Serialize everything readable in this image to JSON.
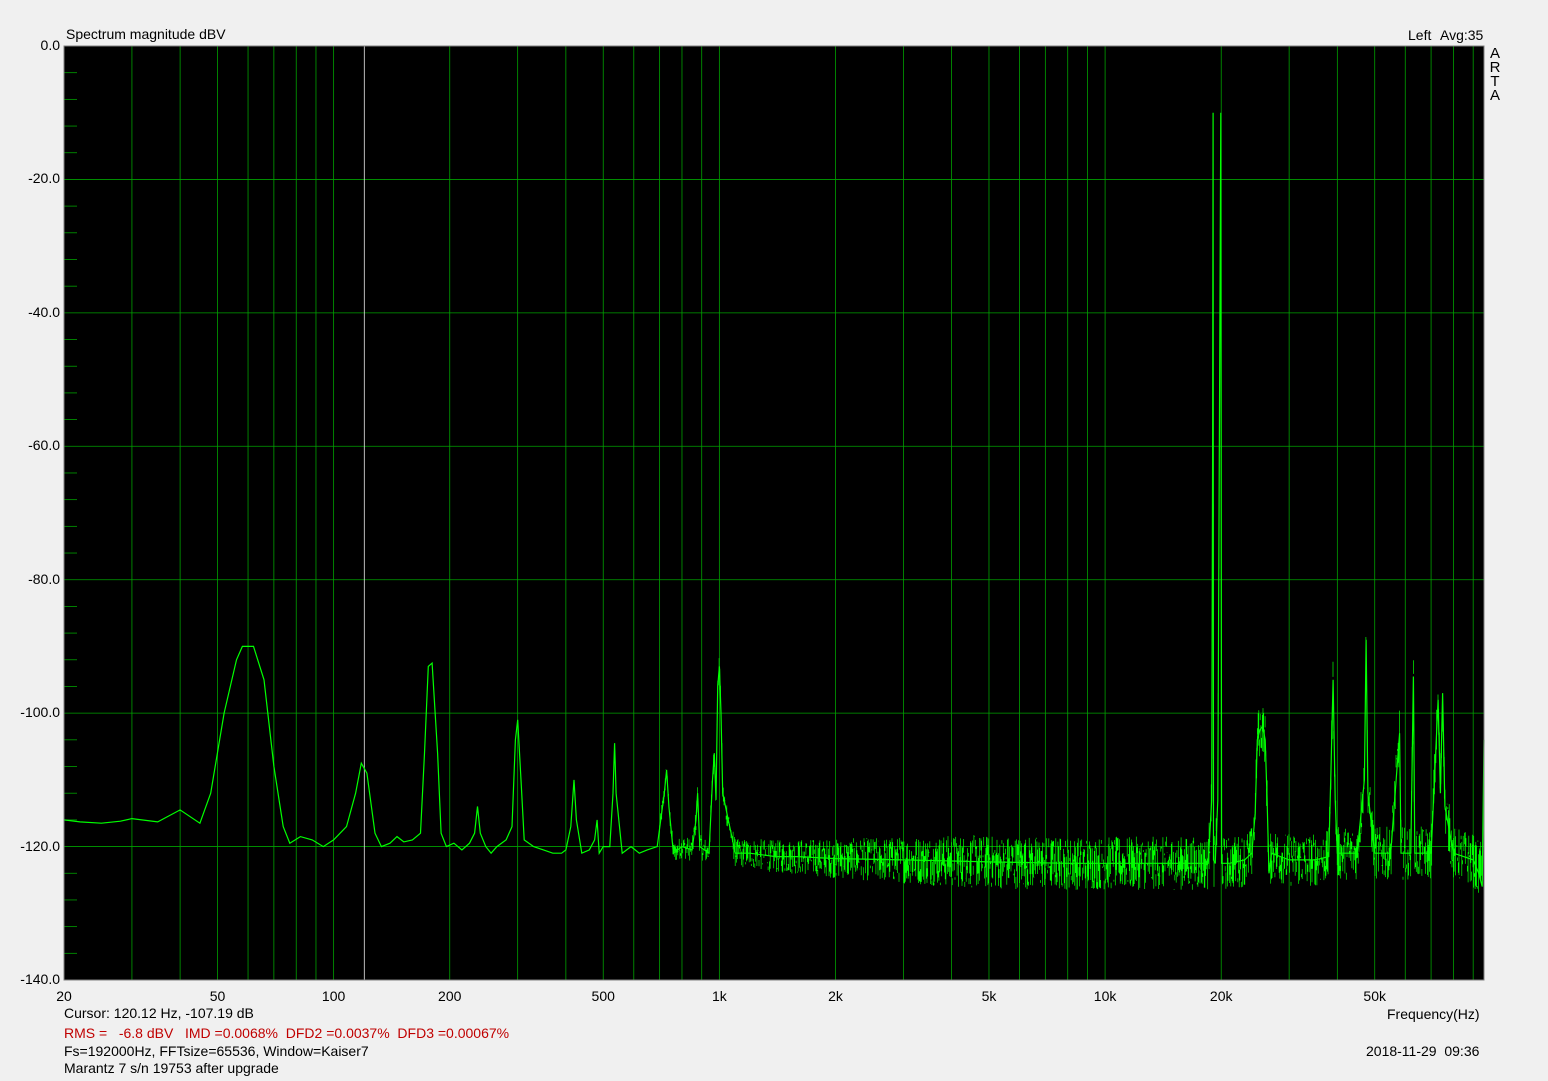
{
  "header": {
    "title": "Spectrum magnitude dBV",
    "channel": "Left",
    "avg": "Avg:35",
    "brand_letters": [
      "A",
      "R",
      "T",
      "A"
    ]
  },
  "footer": {
    "cursor": "Cursor: 120.12 Hz, -107.19 dB",
    "rms": "RMS =   -6.8 dBV   IMD =0.0068%  DFD2 =0.0037%  DFD3 =0.00067%",
    "fft": "Fs=192000Hz, FFTsize=65536, Window=Kaiser7",
    "device": "Marantz 7 s/n 19753 after upgrade",
    "frequency_label": "Frequency(Hz)",
    "datetime": "2018-11-29  09:36"
  },
  "colors": {
    "background": "#000000",
    "grid": "#00a000",
    "trace": "#00ff00",
    "window": "#f0f0f0",
    "stats_text": "#c00000"
  },
  "chart_data": {
    "type": "line",
    "title": "Spectrum magnitude dBV",
    "xlabel": "Frequency(Hz)",
    "ylabel": "dBV",
    "xscale": "log",
    "xlim": [
      20,
      96000
    ],
    "ylim": [
      -140,
      0
    ],
    "grid": true,
    "x_tick_labels": [
      {
        "value": 20,
        "label": "20"
      },
      {
        "value": 50,
        "label": "50"
      },
      {
        "value": 100,
        "label": "100"
      },
      {
        "value": 200,
        "label": "200"
      },
      {
        "value": 500,
        "label": "500"
      },
      {
        "value": 1000,
        "label": "1k"
      },
      {
        "value": 2000,
        "label": "2k"
      },
      {
        "value": 5000,
        "label": "5k"
      },
      {
        "value": 10000,
        "label": "10k"
      },
      {
        "value": 20000,
        "label": "20k"
      },
      {
        "value": 50000,
        "label": "50k"
      }
    ],
    "y_tick_labels": [
      {
        "value": 0,
        "label": "0.0"
      },
      {
        "value": -20,
        "label": "-20.0"
      },
      {
        "value": -40,
        "label": "-40.0"
      },
      {
        "value": -60,
        "label": "-60.0"
      },
      {
        "value": -80,
        "label": "-80.0"
      },
      {
        "value": -100,
        "label": "-100.0"
      },
      {
        "value": -120,
        "label": "-120.0"
      },
      {
        "value": -140,
        "label": "-140.0"
      }
    ],
    "series": [
      {
        "color": "#00ff00",
        "points": [
          [
            20,
            -116
          ],
          [
            22,
            -116.3
          ],
          [
            25,
            -116.5
          ],
          [
            28,
            -116.2
          ],
          [
            30,
            -115.8
          ],
          [
            35,
            -116.3
          ],
          [
            40,
            -114.5
          ],
          [
            45,
            -116.5
          ],
          [
            48,
            -112
          ],
          [
            52,
            -100
          ],
          [
            56,
            -92
          ],
          [
            58,
            -90
          ],
          [
            62,
            -90
          ],
          [
            66,
            -95
          ],
          [
            70,
            -108
          ],
          [
            74,
            -117
          ],
          [
            77,
            -119.5
          ],
          [
            82,
            -118.5
          ],
          [
            88,
            -119
          ],
          [
            94,
            -120
          ],
          [
            100,
            -119
          ],
          [
            108,
            -117
          ],
          [
            114,
            -112
          ],
          [
            118,
            -107.5
          ],
          [
            122,
            -109
          ],
          [
            128,
            -118
          ],
          [
            133,
            -120
          ],
          [
            140,
            -119.5
          ],
          [
            146,
            -118.5
          ],
          [
            152,
            -119.3
          ],
          [
            160,
            -119
          ],
          [
            168,
            -118
          ],
          [
            172,
            -106
          ],
          [
            176,
            -93
          ],
          [
            180,
            -92.5
          ],
          [
            186,
            -106
          ],
          [
            190,
            -118
          ],
          [
            196,
            -120
          ],
          [
            205,
            -119.5
          ],
          [
            215,
            -120.5
          ],
          [
            225,
            -119.5
          ],
          [
            232,
            -118
          ],
          [
            236,
            -114
          ],
          [
            240,
            -118
          ],
          [
            248,
            -120
          ],
          [
            256,
            -121
          ],
          [
            265,
            -120
          ],
          [
            280,
            -119
          ],
          [
            290,
            -117
          ],
          [
            296,
            -104
          ],
          [
            300,
            -101
          ],
          [
            306,
            -110
          ],
          [
            312,
            -119
          ],
          [
            330,
            -120
          ],
          [
            350,
            -120.5
          ],
          [
            370,
            -121
          ],
          [
            390,
            -121
          ],
          [
            400,
            -120.5
          ],
          [
            412,
            -117
          ],
          [
            420,
            -110
          ],
          [
            426,
            -116
          ],
          [
            440,
            -121
          ],
          [
            460,
            -120.5
          ],
          [
            475,
            -119
          ],
          [
            482,
            -116
          ],
          [
            488,
            -121
          ],
          [
            500,
            -120
          ],
          [
            520,
            -120
          ],
          [
            530,
            -112
          ],
          [
            535,
            -104.5
          ],
          [
            540,
            -112
          ],
          [
            560,
            -121
          ],
          [
            590,
            -120
          ],
          [
            620,
            -121
          ],
          [
            650,
            -120.5
          ],
          [
            690,
            -120
          ],
          [
            720,
            -112
          ],
          [
            730,
            -108.5
          ],
          [
            740,
            -114
          ],
          [
            760,
            -121
          ],
          [
            800,
            -120
          ],
          [
            850,
            -120.5
          ],
          [
            870,
            -116
          ],
          [
            878,
            -112
          ],
          [
            890,
            -120
          ],
          [
            940,
            -121
          ],
          [
            960,
            -110
          ],
          [
            970,
            -106
          ],
          [
            980,
            -113
          ],
          [
            990,
            -96
          ],
          [
            1000,
            -93
          ],
          [
            1010,
            -100
          ],
          [
            1020,
            -112
          ],
          [
            1100,
            -121
          ],
          [
            1200,
            -121
          ],
          [
            1400,
            -121.5
          ],
          [
            1600,
            -121.5
          ],
          [
            2000,
            -121.8
          ],
          [
            3000,
            -122
          ],
          [
            5000,
            -122.3
          ],
          [
            8000,
            -122.5
          ],
          [
            10000,
            -122.5
          ],
          [
            15000,
            -122.5
          ],
          [
            18500,
            -122.5
          ],
          [
            18900,
            -113
          ],
          [
            19000,
            -60.8
          ],
          [
            19050,
            -10
          ],
          [
            19100,
            -122
          ],
          [
            19300,
            -122.5
          ],
          [
            19600,
            -113
          ],
          [
            19950,
            -10
          ],
          [
            20050,
            -122.5
          ],
          [
            21000,
            -122.5
          ],
          [
            23000,
            -122
          ],
          [
            24000,
            -121
          ],
          [
            24500,
            -115
          ],
          [
            24800,
            -104
          ],
          [
            25200,
            -102.5
          ],
          [
            25600,
            -102
          ],
          [
            26000,
            -104
          ],
          [
            26300,
            -113
          ],
          [
            26600,
            -124
          ],
          [
            27000,
            -121
          ],
          [
            30000,
            -122
          ],
          [
            35000,
            -122
          ],
          [
            38000,
            -121.5
          ],
          [
            38500,
            -109
          ],
          [
            39000,
            -95
          ],
          [
            39500,
            -113
          ],
          [
            40000,
            -121
          ],
          [
            45000,
            -121
          ],
          [
            47000,
            -110
          ],
          [
            47500,
            -89
          ],
          [
            48000,
            -112
          ],
          [
            50000,
            -121
          ],
          [
            55000,
            -121
          ],
          [
            58000,
            -103
          ],
          [
            58500,
            -121
          ],
          [
            62000,
            -121
          ],
          [
            63000,
            -94.5
          ],
          [
            63500,
            -121
          ],
          [
            70000,
            -121
          ],
          [
            73000,
            -98
          ],
          [
            74000,
            -112
          ],
          [
            75000,
            -97
          ],
          [
            76000,
            -114
          ],
          [
            80000,
            -121
          ],
          [
            85000,
            -121.5
          ],
          [
            90000,
            -122
          ],
          [
            93000,
            -124
          ],
          [
            95000,
            -126
          ],
          [
            96000,
            -104
          ]
        ]
      }
    ]
  }
}
